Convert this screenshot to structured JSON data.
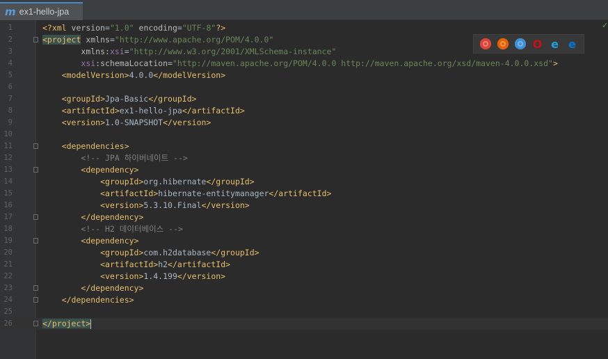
{
  "tab": {
    "title": "ex1-hello-jpa",
    "icon": "m"
  },
  "status": {
    "check": "✓"
  },
  "browser_icons": [
    {
      "name": "chrome-icon",
      "color": "#db4437"
    },
    {
      "name": "firefox-icon",
      "color": "#e66000"
    },
    {
      "name": "safari-icon",
      "color": "#3d8fd6"
    },
    {
      "name": "opera-icon",
      "color": "#cc0f16"
    },
    {
      "name": "ie-icon",
      "color": "#1ba1e2"
    },
    {
      "name": "edge-icon",
      "color": "#0078d7"
    }
  ],
  "editor": {
    "lines": [
      {
        "n": "1",
        "segs": [
          [
            "t",
            "<?xml "
          ],
          [
            "a",
            "version"
          ],
          [
            "tx",
            "="
          ],
          [
            "v",
            "\"1.0\""
          ],
          [
            "tx",
            " "
          ],
          [
            "a",
            "encoding"
          ],
          [
            "tx",
            "="
          ],
          [
            "v",
            "\"UTF-8\""
          ],
          [
            "t",
            "?>"
          ]
        ]
      },
      {
        "n": "2",
        "segs": [
          [
            "hlt",
            "<project"
          ],
          [
            "tx",
            " "
          ],
          [
            "a",
            "xmlns"
          ],
          [
            "tx",
            "="
          ],
          [
            "v",
            "\"http://www.apache.org/POM/4.0.0\""
          ]
        ]
      },
      {
        "n": "3",
        "segs": [
          [
            "tx",
            "        "
          ],
          [
            "a",
            "xmlns:"
          ],
          [
            "ns",
            "xsi"
          ],
          [
            "tx",
            "="
          ],
          [
            "v",
            "\"http://www.w3.org/2001/XMLSchema-instance\""
          ]
        ]
      },
      {
        "n": "4",
        "segs": [
          [
            "tx",
            "        "
          ],
          [
            "ns",
            "xsi"
          ],
          [
            "a",
            ":schemaLocation"
          ],
          [
            "tx",
            "="
          ],
          [
            "v",
            "\"http://maven.apache.org/POM/4.0.0 http://maven.apache.org/xsd/maven-4.0.0.xsd\""
          ],
          [
            "t",
            ">"
          ]
        ]
      },
      {
        "n": "5",
        "segs": [
          [
            "tx",
            "    "
          ],
          [
            "t",
            "<modelVersion>"
          ],
          [
            "tx",
            "4.0.0"
          ],
          [
            "t",
            "</modelVersion>"
          ]
        ]
      },
      {
        "n": "6",
        "segs": []
      },
      {
        "n": "7",
        "segs": [
          [
            "tx",
            "    "
          ],
          [
            "t",
            "<groupId>"
          ],
          [
            "tx",
            "Jpa-Basic"
          ],
          [
            "t",
            "</groupId>"
          ]
        ]
      },
      {
        "n": "8",
        "segs": [
          [
            "tx",
            "    "
          ],
          [
            "t",
            "<artifactId>"
          ],
          [
            "tx",
            "ex1-hello-jpa"
          ],
          [
            "t",
            "</artifactId>"
          ]
        ]
      },
      {
        "n": "9",
        "segs": [
          [
            "tx",
            "    "
          ],
          [
            "t",
            "<version>"
          ],
          [
            "tx",
            "1.0-SNAPSHOT"
          ],
          [
            "t",
            "</version>"
          ]
        ]
      },
      {
        "n": "10",
        "segs": []
      },
      {
        "n": "11",
        "segs": [
          [
            "tx",
            "    "
          ],
          [
            "t",
            "<dependencies>"
          ]
        ]
      },
      {
        "n": "12",
        "segs": [
          [
            "tx",
            "        "
          ],
          [
            "c",
            "<!-- JPA 하이버네이트 -->"
          ]
        ]
      },
      {
        "n": "13",
        "segs": [
          [
            "tx",
            "        "
          ],
          [
            "t",
            "<dependency>"
          ]
        ]
      },
      {
        "n": "14",
        "segs": [
          [
            "tx",
            "            "
          ],
          [
            "t",
            "<groupId>"
          ],
          [
            "tx",
            "org.hibernate"
          ],
          [
            "t",
            "</groupId>"
          ]
        ]
      },
      {
        "n": "15",
        "segs": [
          [
            "tx",
            "            "
          ],
          [
            "t",
            "<artifactId>"
          ],
          [
            "tx",
            "hibernate-entitymanager"
          ],
          [
            "t",
            "</artifactId>"
          ]
        ]
      },
      {
        "n": "16",
        "segs": [
          [
            "tx",
            "            "
          ],
          [
            "t",
            "<version>"
          ],
          [
            "tx",
            "5.3.10.Final"
          ],
          [
            "t",
            "</version>"
          ]
        ]
      },
      {
        "n": "17",
        "segs": [
          [
            "tx",
            "        "
          ],
          [
            "t",
            "</dependency>"
          ]
        ]
      },
      {
        "n": "18",
        "segs": [
          [
            "tx",
            "        "
          ],
          [
            "c",
            "<!-- H2 데이터베이스 -->"
          ]
        ]
      },
      {
        "n": "19",
        "segs": [
          [
            "tx",
            "        "
          ],
          [
            "t",
            "<dependency>"
          ]
        ]
      },
      {
        "n": "20",
        "segs": [
          [
            "tx",
            "            "
          ],
          [
            "t",
            "<groupId>"
          ],
          [
            "tx",
            "com.h2database"
          ],
          [
            "t",
            "</groupId>"
          ]
        ]
      },
      {
        "n": "21",
        "segs": [
          [
            "tx",
            "            "
          ],
          [
            "t",
            "<artifactId>"
          ],
          [
            "tx",
            "h2"
          ],
          [
            "t",
            "</artifactId>"
          ]
        ]
      },
      {
        "n": "22",
        "segs": [
          [
            "tx",
            "            "
          ],
          [
            "t",
            "<version>"
          ],
          [
            "tx",
            "1.4.199"
          ],
          [
            "t",
            "</version>"
          ]
        ]
      },
      {
        "n": "23",
        "segs": [
          [
            "tx",
            "        "
          ],
          [
            "t",
            "</dependency>"
          ]
        ]
      },
      {
        "n": "24",
        "segs": [
          [
            "tx",
            "    "
          ],
          [
            "t",
            "</dependencies>"
          ]
        ]
      },
      {
        "n": "25",
        "segs": []
      },
      {
        "n": "26",
        "segs": [
          [
            "hlt",
            "</project>"
          ]
        ],
        "current": true
      }
    ],
    "folds": [
      "2",
      "11",
      "13",
      "17",
      "19",
      "23",
      "24",
      "26"
    ]
  }
}
